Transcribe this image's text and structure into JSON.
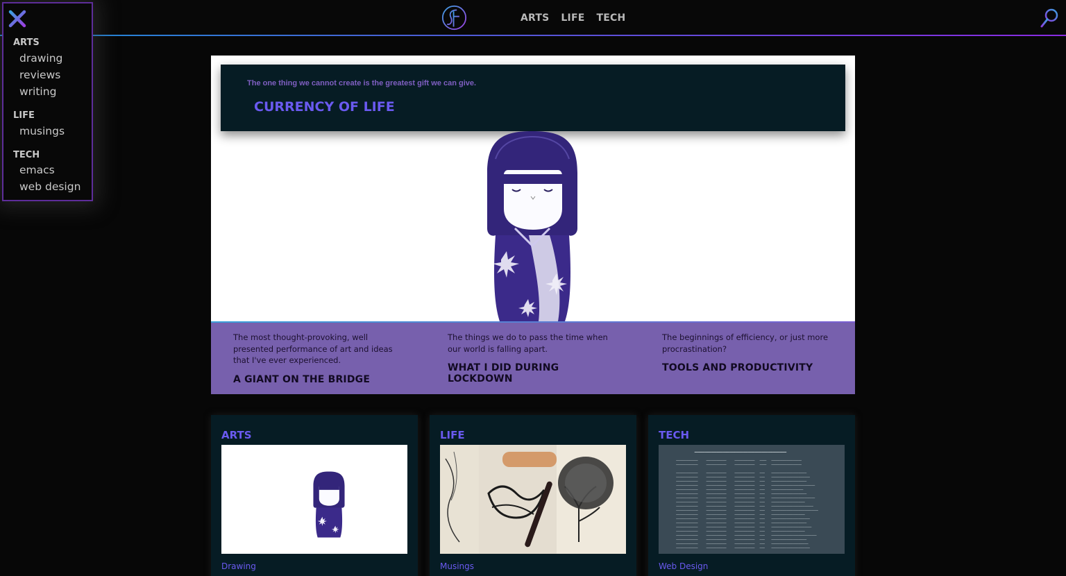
{
  "colors": {
    "accent": "#6a5af0",
    "band": "#7760ad",
    "card": "#061c24",
    "menu_border": "#5e2d9a"
  },
  "header": {
    "logo_icon": "cf-monogram-logo",
    "nav": [
      "ARTS",
      "LIFE",
      "TECH"
    ],
    "search_icon": "search-icon"
  },
  "sidemenu": {
    "close_icon": "close-icon",
    "sections": [
      {
        "heading": "ARTS",
        "items": [
          "drawing",
          "reviews",
          "writing"
        ]
      },
      {
        "heading": "LIFE",
        "items": [
          "musings"
        ]
      },
      {
        "heading": "TECH",
        "items": [
          "emacs",
          "web design"
        ]
      }
    ]
  },
  "hero": {
    "subtitle": "The one thing we cannot create is the greatest gift we can give.",
    "title": "CURRENCY OF LIFE",
    "features": [
      {
        "desc": "The most thought-provoking, well presented performance of art and ideas that I've ever experienced.",
        "title": "A GIANT ON THE BRIDGE"
      },
      {
        "desc": "The things we do to pass the time when our world is falling apart.",
        "title": "WHAT I DID DURING LOCKDOWN"
      },
      {
        "desc": "The beginnings of efficiency, or just more procrastination?",
        "title": "TOOLS AND PRODUCTIVITY"
      }
    ]
  },
  "cards": [
    {
      "title": "ARTS",
      "link": "Drawing"
    },
    {
      "title": "LIFE",
      "link": "Musings"
    },
    {
      "title": "TECH",
      "link": "Web Design"
    }
  ]
}
